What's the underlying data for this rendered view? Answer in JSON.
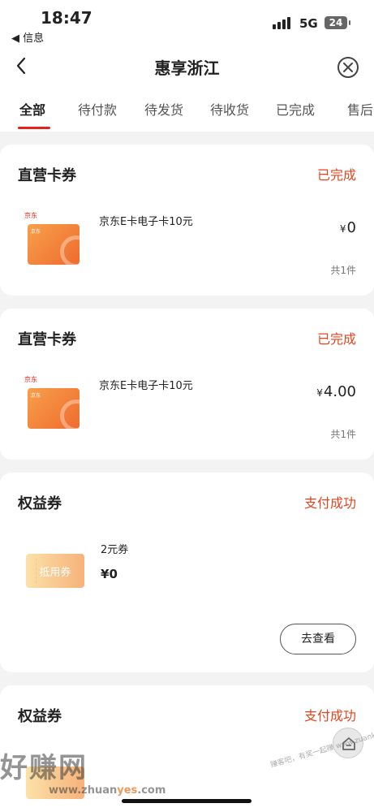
{
  "status_bar": {
    "time": "18:47",
    "back_app": "◀ 信息",
    "network": "5G",
    "battery": "24"
  },
  "header": {
    "title": "惠享浙江",
    "back_icon": "chevron-left-icon",
    "close_icon": "close-circle-icon"
  },
  "tabs": [
    {
      "label": "全部",
      "active": true
    },
    {
      "label": "待付款"
    },
    {
      "label": "待发货"
    },
    {
      "label": "待收货"
    },
    {
      "label": "已完成"
    },
    {
      "label": "售后"
    }
  ],
  "orders": [
    {
      "category": "直营卡券",
      "status": "已完成",
      "brand": "京东",
      "product": "京东E卡电子卡10元",
      "currency": "¥",
      "price": "0",
      "qty": "共1件"
    },
    {
      "category": "直营卡券",
      "status": "已完成",
      "brand": "京东",
      "product": "京东E卡电子卡10元",
      "currency": "¥",
      "price": "4.00",
      "qty": "共1件"
    },
    {
      "category": "权益券",
      "status": "支付成功",
      "voucher_label": "抵用券",
      "product": "2元券",
      "currency": "¥",
      "price": "0",
      "action": "去查看"
    },
    {
      "category": "权益券",
      "status": "支付成功"
    }
  ],
  "watermark": {
    "brand": "好赚网",
    "url_prefix": "www.zhuan",
    "url_highlight": "yes",
    "url_suffix": ".com",
    "site": "赚客吧，有奖一起赚 www.zuanke8.com"
  },
  "colors": {
    "accent_red": "#e2231a",
    "status_orange": "#e2451f",
    "card_orange": "#ef6b2e"
  }
}
